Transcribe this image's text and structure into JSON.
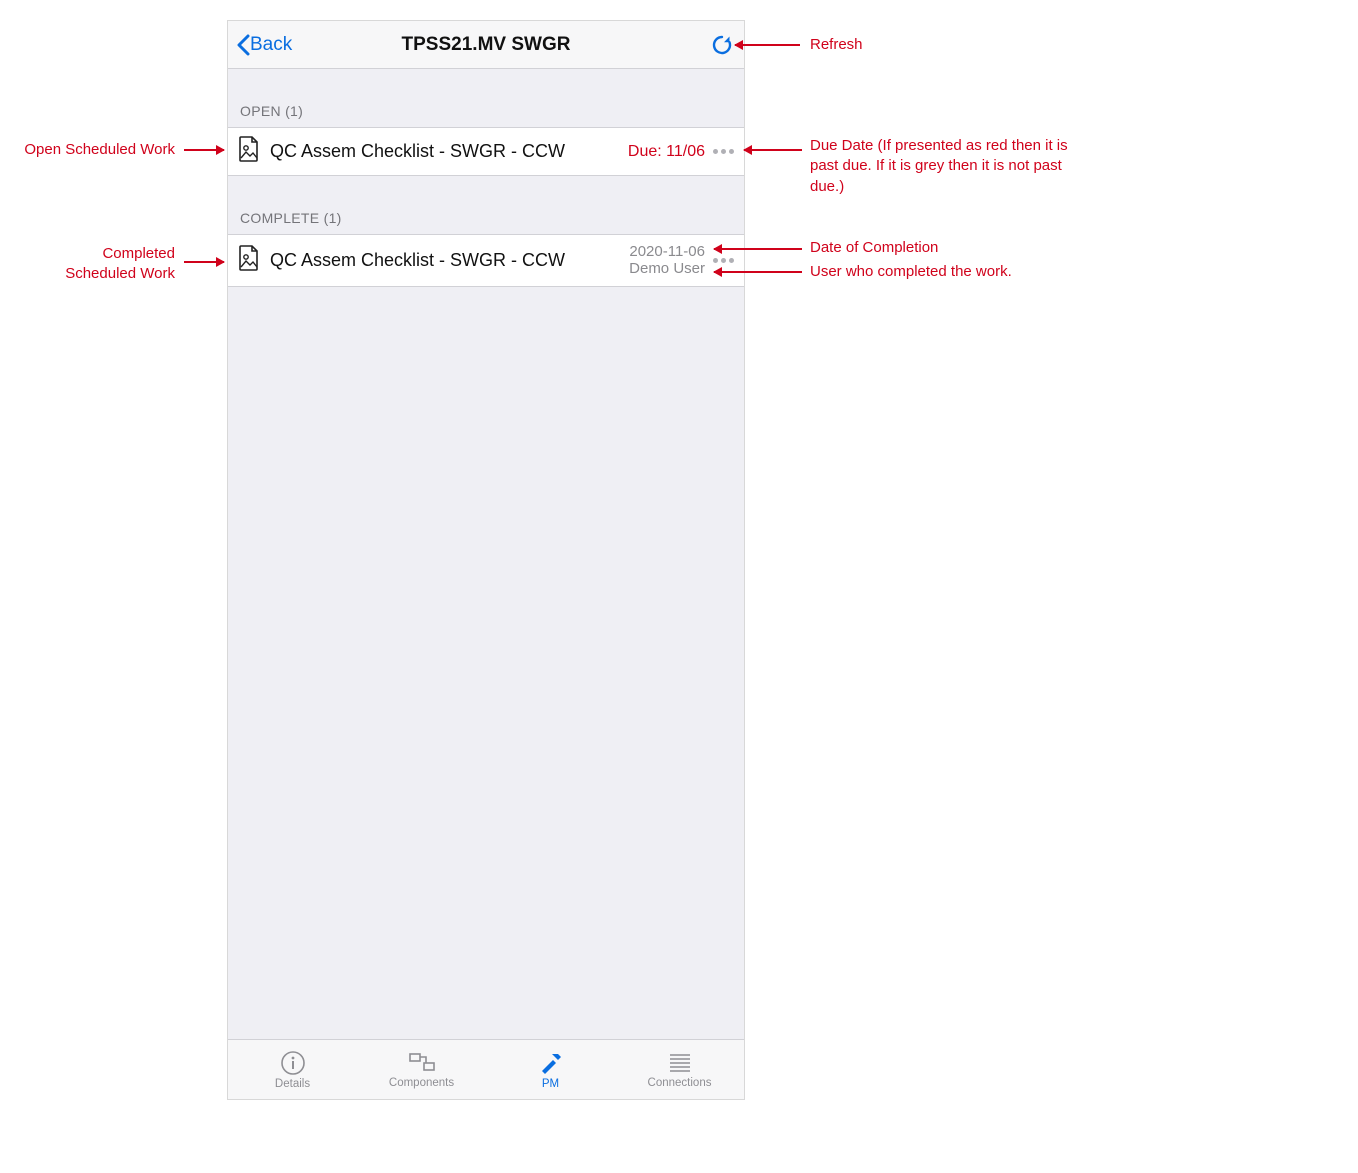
{
  "header": {
    "back_label": "Back",
    "title": "TPSS21.MV SWGR"
  },
  "sections": {
    "open": {
      "header": "OPEN (1)",
      "items": [
        {
          "title": "QC Assem Checklist - SWGR - CCW",
          "due_label": "Due: 11/06",
          "past_due": true
        }
      ]
    },
    "complete": {
      "header": "COMPLETE (1)",
      "items": [
        {
          "title": "QC Assem Checklist - SWGR - CCW",
          "completed_date": "2020-11-06",
          "completed_by": "Demo User"
        }
      ]
    }
  },
  "tabs": {
    "details": "Details",
    "components": "Components",
    "pm": "PM",
    "connections": "Connections",
    "active": "pm"
  },
  "callouts": {
    "refresh": "Refresh",
    "open_work": "Open Scheduled Work",
    "due_date": "Due Date (If presented as red then it is past due. If it is grey then it is not past due.)",
    "completed_work": "Completed\nScheduled Work",
    "completion_date": "Date of Completion",
    "completed_user": "User who completed the work."
  }
}
